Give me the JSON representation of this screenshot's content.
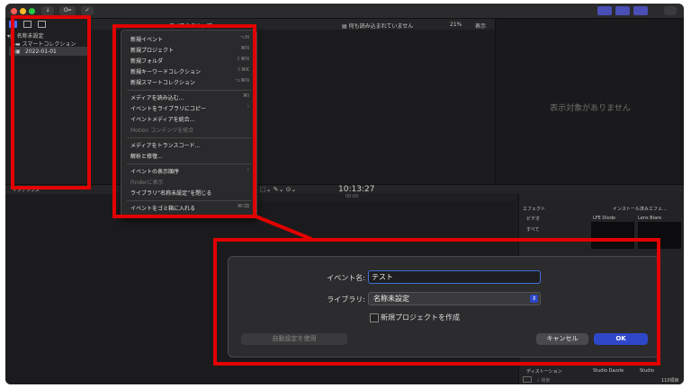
{
  "toolbar": {
    "btn_import": "↓",
    "btn_key": "O━",
    "btn_check": "✓"
  },
  "browser": {
    "title": "すべてのクリップ",
    "status": "何も読み込まれていません",
    "zoom": "21%",
    "view": "表示"
  },
  "sidebar": {
    "library": "名称未設定",
    "smart_collection": "スマートコレクション",
    "event": "2022-01-01"
  },
  "viewer": {
    "empty_text": "表示対象がありません"
  },
  "menu": {
    "items": [
      {
        "label": "新規イベント",
        "shortcut": "⌥N"
      },
      {
        "label": "新規プロジェクト",
        "shortcut": "⌘N"
      },
      {
        "label": "新規フォルダ",
        "shortcut": "⇧⌘N"
      },
      {
        "label": "新規キーワードコレクション",
        "shortcut": "⇧⌘K"
      },
      {
        "label": "新規スマートコレクション",
        "shortcut": "⌥⌘N"
      },
      {
        "label": "メディアを読み込む...",
        "shortcut": "⌘I"
      },
      {
        "label": "イベントをライブラリにコピー",
        "shortcut": "›"
      },
      {
        "label": "イベントメディアを統合...",
        "shortcut": ""
      },
      {
        "label": "Motion コンテンツを統合",
        "shortcut": ""
      },
      {
        "label": "メディアをトランスコード...",
        "shortcut": ""
      },
      {
        "label": "解析と修復...",
        "shortcut": ""
      },
      {
        "label": "イベントの表示順序",
        "shortcut": "›"
      },
      {
        "label": "Finderに表示",
        "shortcut": ""
      },
      {
        "label": "ライブラリ“名称未設定”を閉じる",
        "shortcut": ""
      },
      {
        "label": "イベントをゴミ箱に入れる",
        "shortcut": "⌘⌫"
      }
    ]
  },
  "timeline": {
    "timecode": "10:13:27",
    "index_label": "インデックス",
    "ruler_label": "00:00"
  },
  "effects": {
    "header": "エフェクト",
    "installed": "インストール済みエフェ…",
    "categories": [
      "ビデオ",
      "すべて"
    ],
    "thumb1": "LFE Diode",
    "thumb2": "Lens Blare",
    "bottom_cat": "ディストーション",
    "bottom1": "Studio Dazzle",
    "bottom2": "Studio",
    "search_placeholder": "検索",
    "count": "110項目"
  },
  "dialog": {
    "event_name_label": "イベント名:",
    "event_name_value": "テスト",
    "library_label": "ライブラリ:",
    "library_value": "名称未設定",
    "create_project_label": "新規プロジェクトを作成",
    "auto_settings_label": "自動設定を使用",
    "cancel_label": "キャンセル",
    "ok_label": "OK"
  },
  "colors": {
    "highlight_red": "#e30000",
    "accent_blue": "#2e47c9"
  }
}
